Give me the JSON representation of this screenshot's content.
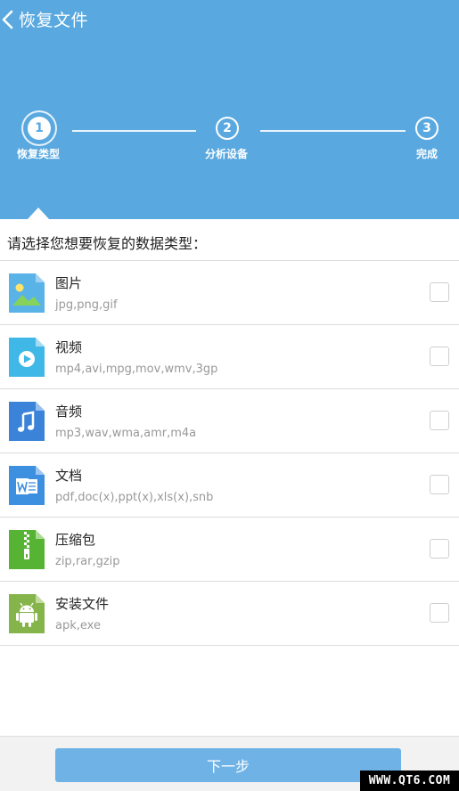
{
  "header": {
    "title": "恢复文件",
    "back_icon": "chevron-left-icon",
    "background": "#59a9e0"
  },
  "steps": [
    {
      "number": "1",
      "label": "恢复类型",
      "active": true
    },
    {
      "number": "2",
      "label": "分析设备",
      "active": false
    },
    {
      "number": "3",
      "label": "完成",
      "active": false
    }
  ],
  "prompt": "请选择您想要恢复的数据类型：",
  "file_types": [
    {
      "name": "图片",
      "extensions": "jpg,png,gif",
      "icon": "image-file-icon",
      "color": "#5ab3e6",
      "checked": false
    },
    {
      "name": "视频",
      "extensions": "mp4,avi,mpg,mov,wmv,3gp",
      "icon": "video-file-icon",
      "color": "#3fb8e8",
      "checked": false
    },
    {
      "name": "音频",
      "extensions": "mp3,wav,wma,amr,m4a",
      "icon": "audio-file-icon",
      "color": "#3b83d9",
      "checked": false
    },
    {
      "name": "文档",
      "extensions": "pdf,doc(x),ppt(x),xls(x),snb",
      "icon": "word-document-icon",
      "color": "#3d8fe0",
      "checked": false
    },
    {
      "name": "压缩包",
      "extensions": "zip,rar,gzip",
      "icon": "zip-archive-icon",
      "color": "#56b334",
      "checked": false
    },
    {
      "name": "安装文件",
      "extensions": "apk,exe",
      "icon": "android-apk-icon",
      "color": "#84b44a",
      "checked": false
    }
  ],
  "footer": {
    "next_label": "下一步",
    "button_color": "#6fb3e6"
  },
  "watermark": "WWW.QT6.COM"
}
